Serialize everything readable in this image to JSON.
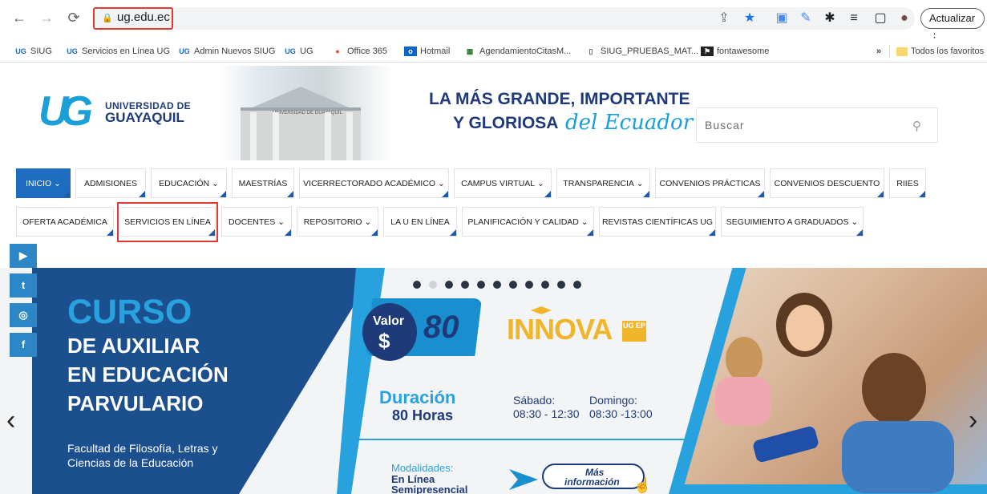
{
  "browser": {
    "url": "ug.edu.ec",
    "update_label": "Actualizar",
    "bookmarks": [
      {
        "icon": "ug-icon",
        "label": "SIUG"
      },
      {
        "icon": "ug-icon",
        "label": "Servicios en Línea UG"
      },
      {
        "icon": "ug-icon",
        "label": "Admin Nuevos SIUG"
      },
      {
        "icon": "ug-icon",
        "label": "UG"
      },
      {
        "icon": "office-icon",
        "label": "Office 365"
      },
      {
        "icon": "outlook-icon",
        "label": "Hotmail"
      },
      {
        "icon": "calendar-icon",
        "label": "AgendamientoCitasM..."
      },
      {
        "icon": "page-icon",
        "label": "SIUG_PRUEBAS_MAT..."
      },
      {
        "icon": "flag-icon",
        "label": "fontawesome"
      }
    ],
    "more_bookmarks": "»",
    "all_bookmarks": "Todos los favoritos"
  },
  "header": {
    "logo_line1": "UNIVERSIDAD DE",
    "logo_line2": "GUAYAQUIL",
    "slogan_line1": "LA MÁS GRANDE, IMPORTANTE",
    "slogan_line2": "Y GLORIOSA",
    "slogan_script": "del Ecuador",
    "building_sign": "UNIVERSIDAD DE GUAYAQUIL",
    "search_placeholder": "Buscar"
  },
  "menu": {
    "row1": [
      {
        "label": "INICIO",
        "dropdown": true
      },
      {
        "label": "ADMISIONES",
        "dropdown": false
      },
      {
        "label": "EDUCACIÓN",
        "dropdown": true
      },
      {
        "label": "MAESTRÍAS",
        "dropdown": false
      },
      {
        "label": "VICERRECTORADO ACADÉMICO",
        "dropdown": true
      },
      {
        "label": "CAMPUS VIRTUAL",
        "dropdown": true
      },
      {
        "label": "TRANSPARENCIA",
        "dropdown": true
      },
      {
        "label": "CONVENIOS PRÁCTICAS",
        "dropdown": false
      },
      {
        "label": "CONVENIOS DESCUENTO",
        "dropdown": false
      },
      {
        "label": "RIIES",
        "dropdown": false
      }
    ],
    "row2": [
      {
        "label": "OFERTA ACADÉMICA",
        "dropdown": false
      },
      {
        "label": "SERVICIOS EN LÍNEA",
        "dropdown": false
      },
      {
        "label": "DOCENTES",
        "dropdown": true
      },
      {
        "label": "REPOSITORIO",
        "dropdown": true
      },
      {
        "label": "LA U EN LÍNEA",
        "dropdown": false
      },
      {
        "label": "PLANIFICACIÓN Y CALIDAD",
        "dropdown": true
      },
      {
        "label": "REVISTAS CIENTÍFICAS UG",
        "dropdown": false
      },
      {
        "label": "SEGUIMIENTO A GRADUADOS",
        "dropdown": true
      }
    ]
  },
  "social": [
    "youtube-icon",
    "twitter-icon",
    "instagram-icon",
    "facebook-icon"
  ],
  "banner": {
    "title": "CURSO",
    "line1": "DE AUXILIAR",
    "line2": "EN EDUCACIÓN",
    "line3": "PARVULARIO",
    "faculty1": "Facultad de Filosofía, Letras y",
    "faculty2": "Ciencias de la Educación",
    "valor": "Valor",
    "currency": "$",
    "price": "80",
    "brand": "INNOVA",
    "brand_tag": "UG EP",
    "duracion": "Duración",
    "horas": "80 Horas",
    "sabado": "Sábado:",
    "sabado_time": "08:30 - 12:30",
    "domingo": "Domingo:",
    "domingo_time": "08:30 -13:00",
    "modalidades": "Modalidades:",
    "mod1": "En Línea",
    "mod2": "Semipresencial",
    "mas1": "Más",
    "mas2": "información",
    "slides": 11,
    "active_slide": 2
  },
  "colors": {
    "accent": "#1e6cc0",
    "brand_dark": "#1e3a78",
    "brand_light": "#28a2de",
    "highlight": "#e53935"
  }
}
